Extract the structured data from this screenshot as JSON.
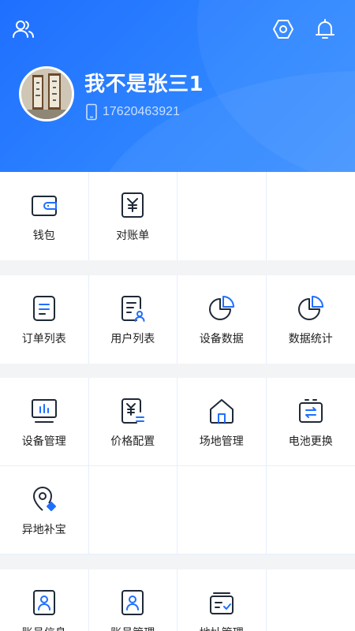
{
  "profile": {
    "name": "我不是张三1",
    "phone": "17620463921"
  },
  "colors": {
    "primary": "#1f6fff",
    "icon_dark": "#1f2937",
    "accent": "#1f6fff"
  },
  "sections": [
    {
      "items": [
        {
          "label": "钱包",
          "icon": "wallet-icon"
        },
        {
          "label": "对账单",
          "icon": "statement-icon"
        }
      ]
    },
    {
      "items": [
        {
          "label": "订单列表",
          "icon": "order-list-icon"
        },
        {
          "label": "用户列表",
          "icon": "user-list-icon"
        },
        {
          "label": "设备数据",
          "icon": "pie-chart-icon"
        },
        {
          "label": "数据统计",
          "icon": "pie-chart-icon"
        }
      ]
    },
    {
      "items": [
        {
          "label": "设备管理",
          "icon": "monitor-icon"
        },
        {
          "label": "价格配置",
          "icon": "price-icon"
        },
        {
          "label": "场地管理",
          "icon": "house-icon"
        },
        {
          "label": "电池更换",
          "icon": "battery-swap-icon"
        },
        {
          "label": "异地补宝",
          "icon": "location-icon"
        }
      ]
    },
    {
      "items": [
        {
          "label": "账号信息",
          "icon": "account-card-icon"
        },
        {
          "label": "账号管理",
          "icon": "account-card-icon"
        },
        {
          "label": "地址管理",
          "icon": "address-icon"
        }
      ]
    }
  ]
}
